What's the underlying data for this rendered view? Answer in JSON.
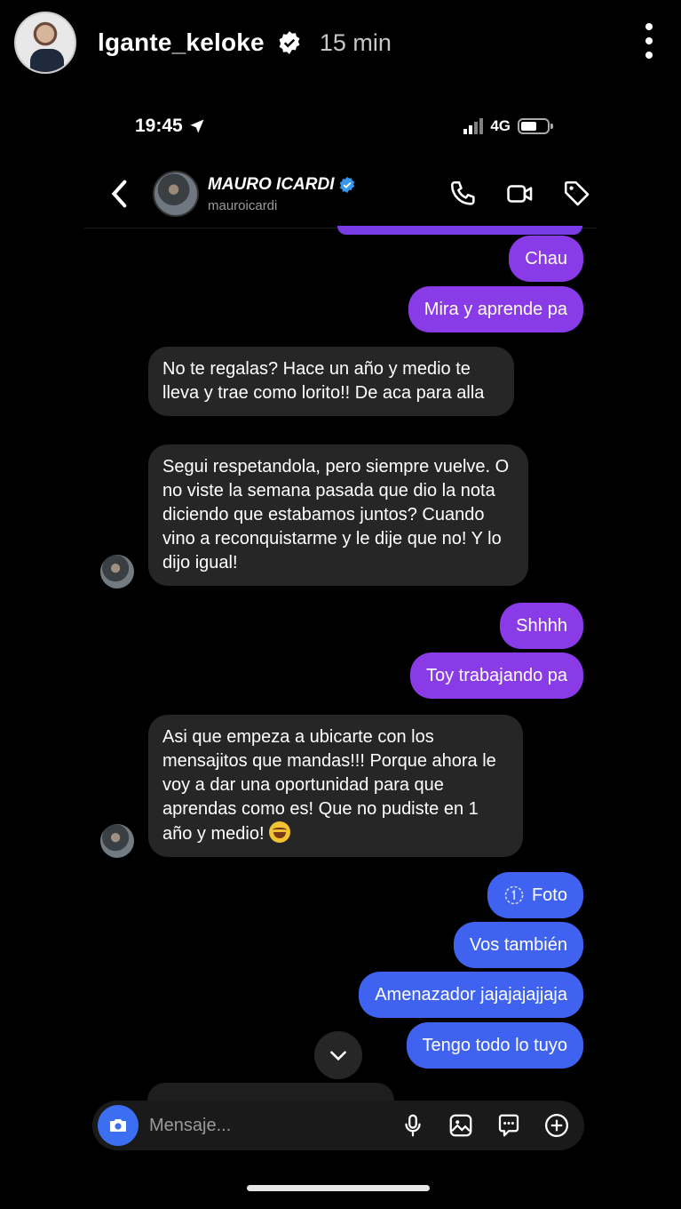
{
  "story": {
    "username": "lgante_keloke",
    "time": "15 min"
  },
  "status_bar": {
    "time": "19:45",
    "network": "4G"
  },
  "chat": {
    "name": "MAURO ICARDI",
    "handle": "mauroicardi"
  },
  "messages": [
    {
      "id": "m1",
      "type": "sent",
      "text": "Chau"
    },
    {
      "id": "m2",
      "type": "sent",
      "text": "Mira y aprende pa"
    },
    {
      "id": "m3",
      "type": "received",
      "text": "No te regalas? Hace un año y medio te lleva y trae como lorito!! De aca para alla"
    },
    {
      "id": "m4",
      "type": "received",
      "text": "Segui respetandola, pero siempre vuelve. O no viste la semana pasada que dio la nota diciendo que estabamos juntos? Cuando vino a reconquistarme y le dije que no! Y lo dijo igual!"
    },
    {
      "id": "m5",
      "type": "sent",
      "text": "Shhhh"
    },
    {
      "id": "m6",
      "type": "sent",
      "text": "Toy trabajando pa"
    },
    {
      "id": "m7",
      "type": "received",
      "text": "Asi que empeza a ubicarte con los mensajitos que mandas!!! Porque ahora le voy a dar una oportunidad para que aprendas como es! Que no pudiste en 1 año y medio!"
    },
    {
      "id": "m8",
      "type": "sent",
      "text": "Foto"
    },
    {
      "id": "m9",
      "type": "sent",
      "text": "Vos también"
    },
    {
      "id": "m10",
      "type": "sent",
      "text": "Amenazador jajajajajjaja"
    },
    {
      "id": "m11",
      "type": "sent",
      "text": "Tengo todo lo tuyo"
    }
  ],
  "composer": {
    "placeholder": "Mensaje..."
  },
  "colors": {
    "sent_purple": "#8a3be8",
    "sent_blue": "#3f63f0",
    "received": "#262626",
    "verified": "#3897f0"
  },
  "icons": [
    "verified-badge-icon",
    "more-options-icon",
    "location-arrow-icon",
    "signal-icon",
    "battery-icon",
    "back-chevron-icon",
    "phone-icon",
    "video-icon",
    "tag-icon",
    "chevron-down-icon",
    "camera-icon",
    "microphone-icon",
    "image-icon",
    "sticker-icon",
    "plus-icon",
    "view-once-icon",
    "laughing-emoji"
  ]
}
